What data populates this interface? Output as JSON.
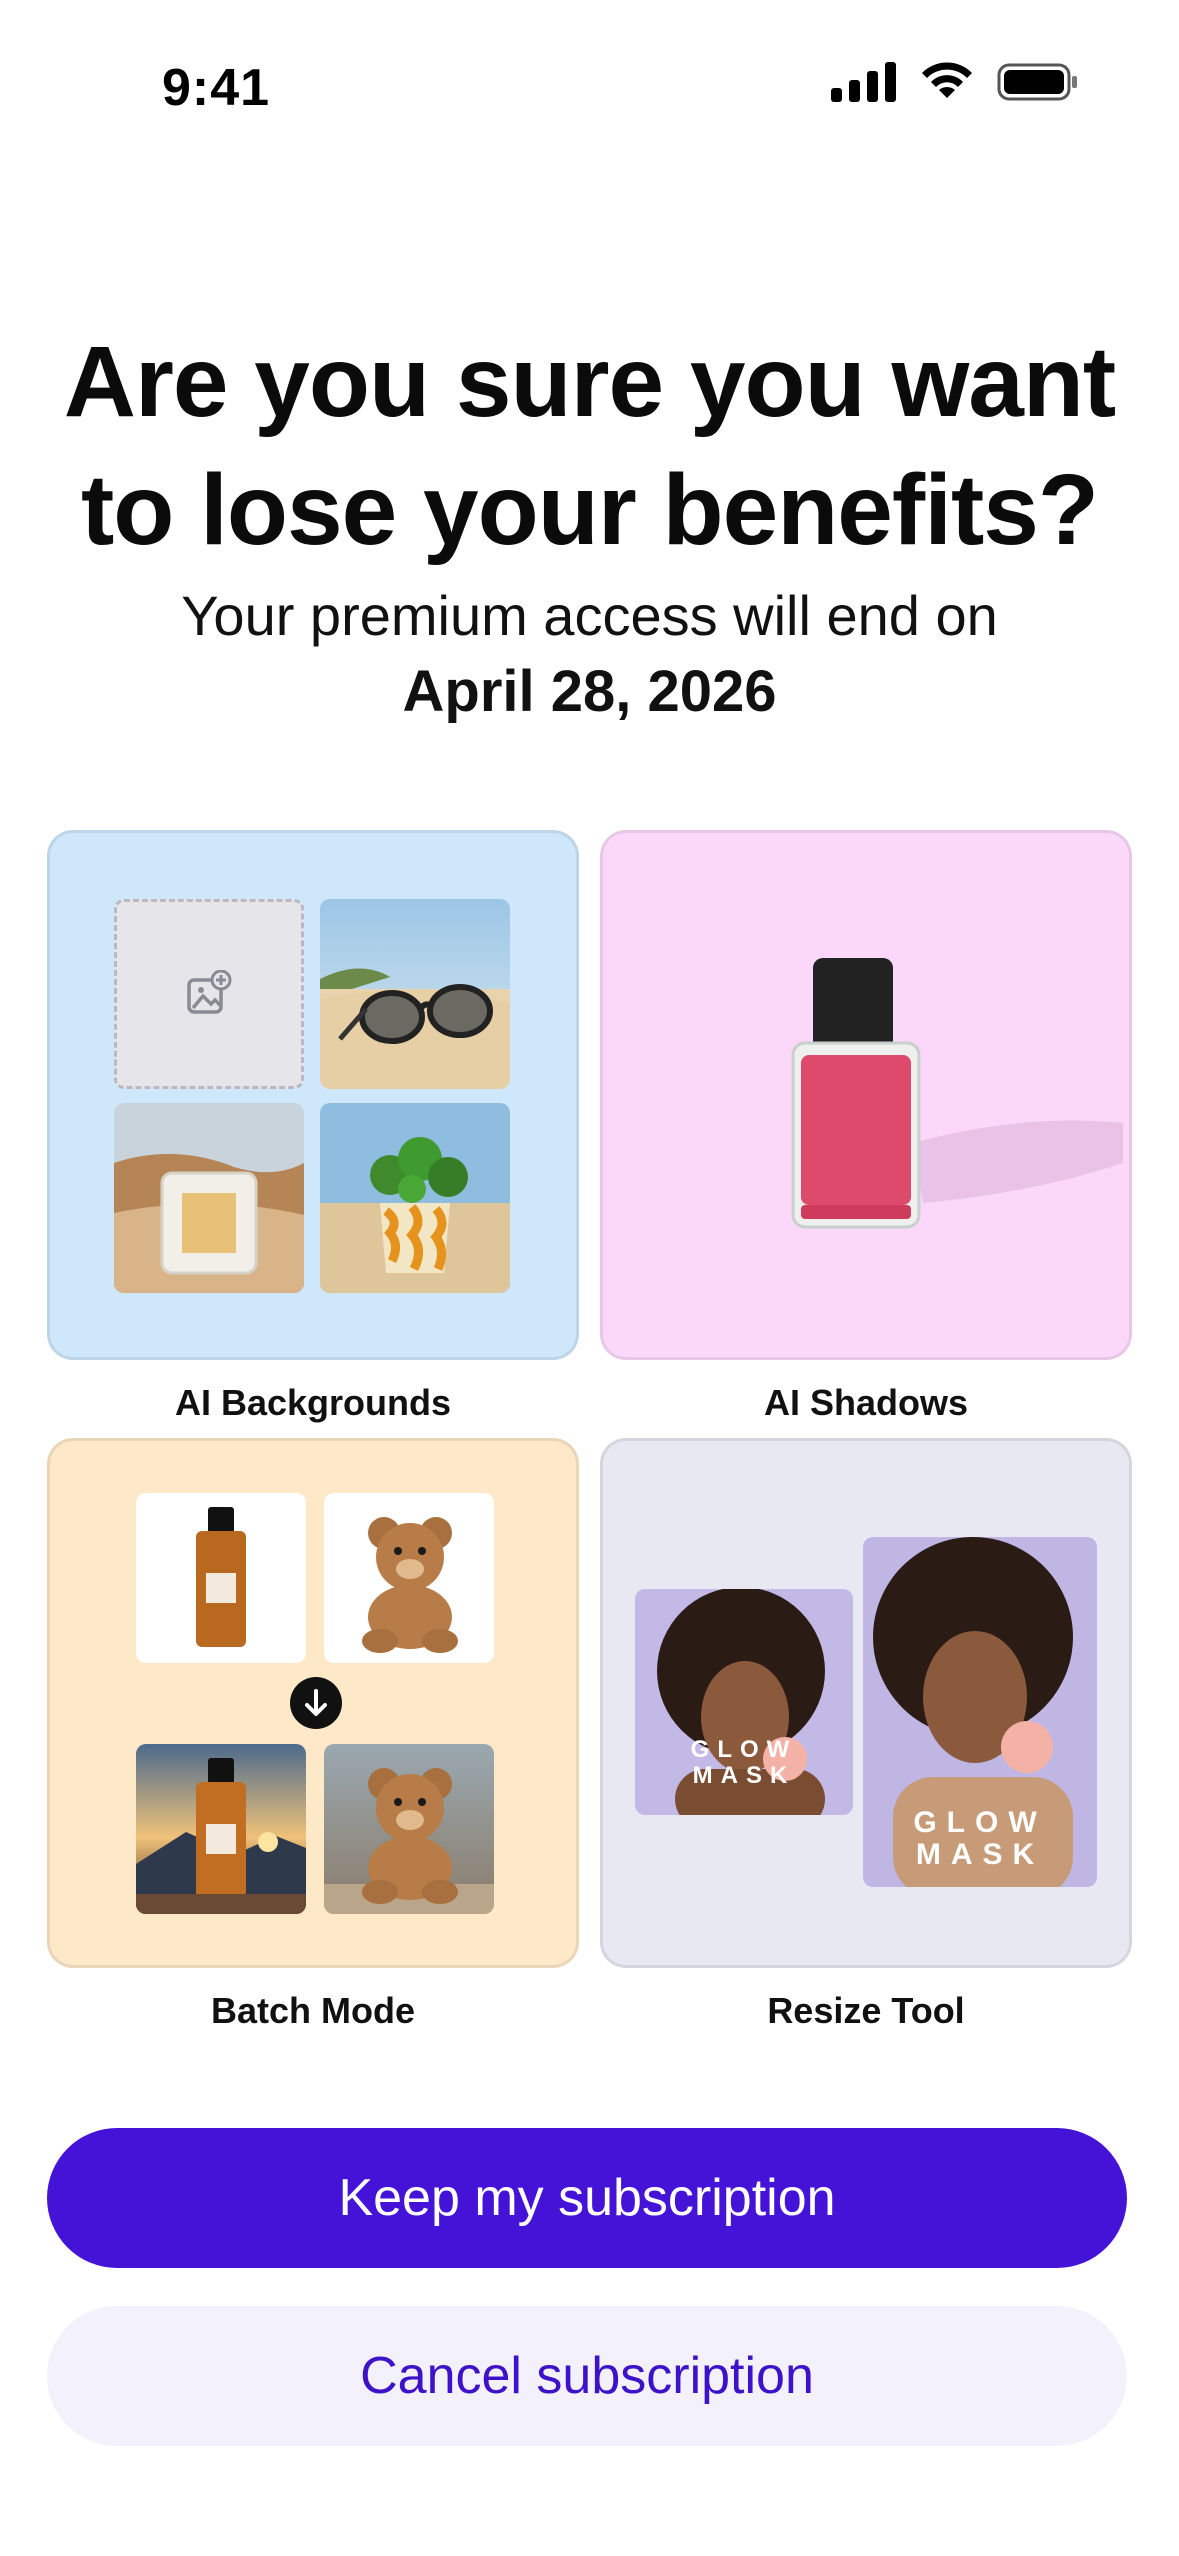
{
  "status_bar": {
    "time": "9:41"
  },
  "header": {
    "title_line1": "Are you sure you want",
    "title_line2": "to lose your benefits?",
    "subtitle": "Your premium access will end on",
    "end_date": "April 28, 2026"
  },
  "features": [
    {
      "label": "AI Backgrounds"
    },
    {
      "label": "AI Shadows"
    },
    {
      "label": "Batch Mode"
    },
    {
      "label": "Resize Tool"
    }
  ],
  "resize_tool": {
    "product_text_line1": "GLOW",
    "product_text_line2": "MASK"
  },
  "actions": {
    "keep_label": "Keep my subscription",
    "cancel_label": "Cancel subscription"
  },
  "colors": {
    "primary": "#4512d8",
    "secondary_bg": "#f3f1fc",
    "bg_card": "#cfe7fb",
    "shadow_card": "#fbd8fa",
    "batch_card": "#fde8c8",
    "resize_card": "#e8e8f3"
  },
  "icons": [
    "cellular-signal-icon",
    "wifi-icon",
    "battery-icon",
    "add-image-icon",
    "arrow-down-icon"
  ]
}
